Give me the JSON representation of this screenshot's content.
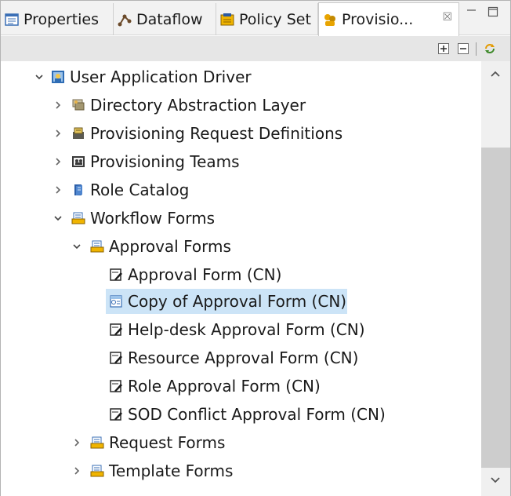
{
  "tabs": [
    {
      "label": "Properties",
      "icon": "properties-icon"
    },
    {
      "label": "Dataflow",
      "icon": "dataflow-icon"
    },
    {
      "label": "Policy Set",
      "icon": "policy-set-icon"
    },
    {
      "label": "Provisio...",
      "icon": "provisioning-view-icon",
      "active": true,
      "close": "☒"
    }
  ],
  "window_controls": {
    "minimize": "minimize-icon",
    "maximize": "maximize-icon"
  },
  "toolbar": {
    "expand_all": "expand-all-icon",
    "collapse_all": "collapse-all-icon",
    "sync": "sync-icon"
  },
  "tree": [
    {
      "label": "User Application Driver",
      "icon": "user-application-driver-icon",
      "state": "expanded",
      "level": 0
    },
    {
      "label": "Directory Abstraction Layer",
      "icon": "directory-abstraction-layer-icon",
      "state": "collapsed",
      "level": 1
    },
    {
      "label": "Provisioning Request Definitions",
      "icon": "provisioning-request-definitions-icon",
      "state": "collapsed",
      "level": 1
    },
    {
      "label": "Provisioning Teams",
      "icon": "provisioning-teams-icon",
      "state": "collapsed",
      "level": 1
    },
    {
      "label": "Role Catalog",
      "icon": "role-catalog-icon",
      "state": "collapsed",
      "level": 1
    },
    {
      "label": "Workflow Forms",
      "icon": "folder-icon",
      "state": "expanded",
      "level": 1
    },
    {
      "label": "Approval Forms",
      "icon": "folder-icon",
      "state": "expanded",
      "level": 2
    },
    {
      "label": "Approval Form (CN)",
      "icon": "form-icon",
      "state": "leaf",
      "level": 3
    },
    {
      "label": "Copy of Approval Form (CN)",
      "icon": "form-copy-icon",
      "state": "leaf",
      "level": 3,
      "selected": true
    },
    {
      "label": "Help-desk Approval Form (CN)",
      "icon": "form-icon",
      "state": "leaf",
      "level": 3
    },
    {
      "label": "Resource Approval Form (CN)",
      "icon": "form-icon",
      "state": "leaf",
      "level": 3
    },
    {
      "label": "Role Approval Form (CN)",
      "icon": "form-icon",
      "state": "leaf",
      "level": 3
    },
    {
      "label": "SOD Conflict Approval Form (CN)",
      "icon": "form-icon",
      "state": "leaf",
      "level": 3
    },
    {
      "label": "Request Forms",
      "icon": "folder-icon",
      "state": "collapsed",
      "level": 2
    },
    {
      "label": "Template Forms",
      "icon": "folder-icon",
      "state": "collapsed",
      "level": 2
    }
  ],
  "scrollbar": {
    "up": "scroll-up-icon",
    "down": "scroll-down-icon"
  },
  "colors": {
    "selection": "#cce4f7",
    "tabbar": "#f2f2f2",
    "toolbar": "#e6e6e6",
    "scroll_thumb": "#cdcdcd"
  }
}
